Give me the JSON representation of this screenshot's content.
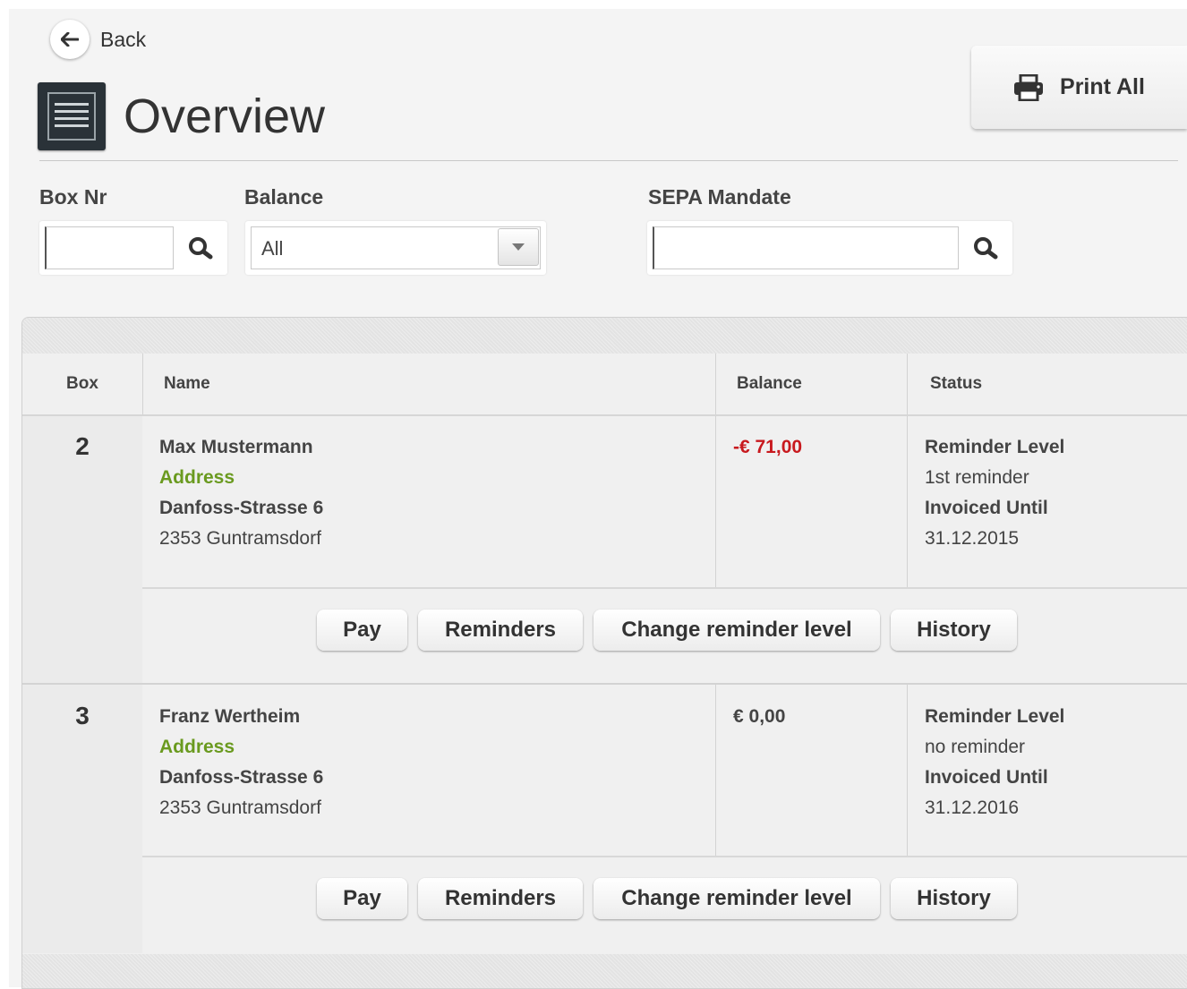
{
  "header": {
    "back_label": "Back",
    "title": "Overview",
    "print_all_label": "Print All"
  },
  "filters": {
    "box_nr_label": "Box Nr",
    "box_nr_value": "",
    "balance_label": "Balance",
    "balance_value": "All",
    "sepa_label": "SEPA Mandate",
    "sepa_value": ""
  },
  "table": {
    "columns": [
      "Box",
      "Name",
      "Balance",
      "Status"
    ],
    "rows": [
      {
        "box": "2",
        "name": "Max Mustermann",
        "address_label": "Address",
        "street": "Danfoss-Strasse 6",
        "city": "2353 Guntramsdorf",
        "balance": "-€ 71,00",
        "balance_negative": true,
        "reminder_level_label": "Reminder Level",
        "reminder_level": "1st reminder",
        "invoiced_until_label": "Invoiced Until",
        "invoiced_until": "31.12.2015",
        "actions": [
          "Pay",
          "Reminders",
          "Change reminder level",
          "History"
        ]
      },
      {
        "box": "3",
        "name": "Franz Wertheim",
        "address_label": "Address",
        "street": "Danfoss-Strasse 6",
        "city": "2353 Guntramsdorf",
        "balance": "€ 0,00",
        "balance_negative": false,
        "reminder_level_label": "Reminder Level",
        "reminder_level": "no reminder",
        "invoiced_until_label": "Invoiced Until",
        "invoiced_until": "31.12.2016",
        "actions": [
          "Pay",
          "Reminders",
          "Change reminder level",
          "History"
        ]
      }
    ]
  },
  "colors": {
    "negative_balance": "#c8191e",
    "address_label": "#6a9a1f",
    "title_icon_bg": "#2a3238"
  },
  "icons": [
    "arrow-left-icon",
    "list-icon",
    "printer-icon",
    "search-icon",
    "chevron-down-icon"
  ]
}
